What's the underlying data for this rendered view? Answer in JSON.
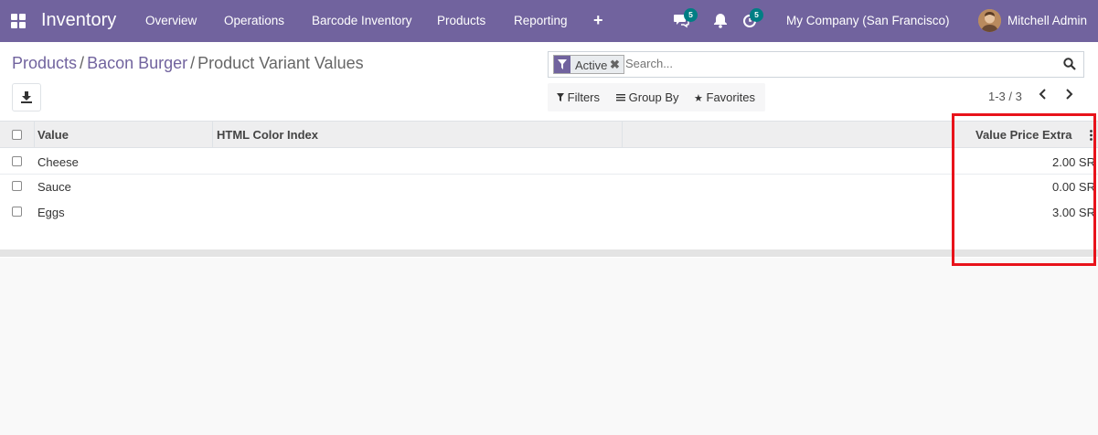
{
  "navbar": {
    "app_name": "Inventory",
    "menu": [
      "Overview",
      "Operations",
      "Barcode Inventory",
      "Products",
      "Reporting"
    ],
    "messages_count": "5",
    "activities_count": "5",
    "company": "My Company (San Francisco)",
    "user": "Mitchell Admin",
    "icons": [
      "apps-grid-icon",
      "plus-icon",
      "chat-icon",
      "bell-icon",
      "clock-icon"
    ]
  },
  "breadcrumb": {
    "items": [
      "Products",
      "Bacon Burger"
    ],
    "current": "Product Variant Values"
  },
  "search": {
    "facet_label": "Active",
    "placeholder": "Search..."
  },
  "filters": {
    "filters_label": "Filters",
    "group_by_label": "Group By",
    "favorites_label": "Favorites"
  },
  "pager": {
    "text": "1-3 / 3"
  },
  "table": {
    "headers": [
      "Value",
      "HTML Color Index",
      "Value Price Extra"
    ],
    "rows": [
      {
        "value": "Cheese",
        "html_color_index": "",
        "price_extra": "2.00 SR"
      },
      {
        "value": "Sauce",
        "html_color_index": "",
        "price_extra": "0.00 SR"
      },
      {
        "value": "Eggs",
        "html_color_index": "",
        "price_extra": "3.00 SR"
      }
    ]
  },
  "colors": {
    "brand": "#71639e",
    "badge": "#017e84",
    "highlight": "#e8131b"
  }
}
